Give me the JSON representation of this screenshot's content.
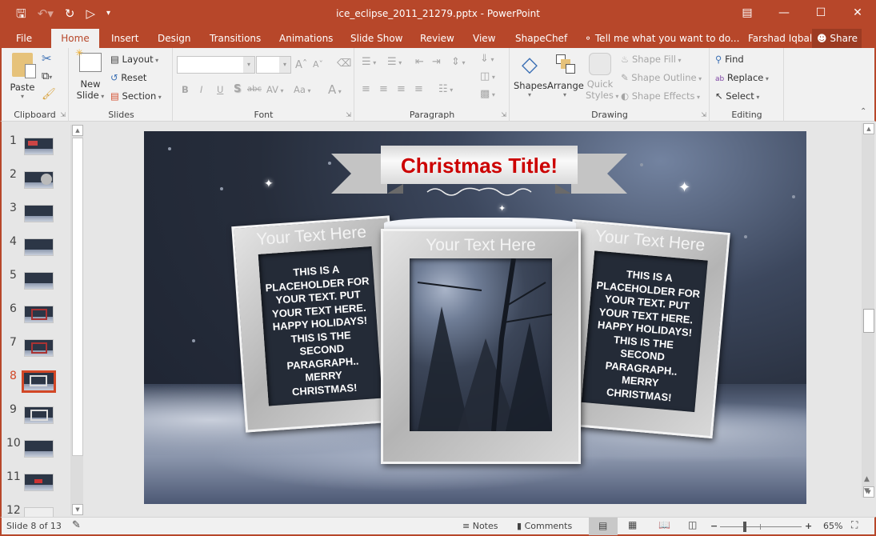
{
  "window": {
    "title": "ice_eclipse_2011_21279.pptx - PowerPoint",
    "controls": [
      "ribbon-display-options",
      "minimize",
      "maximize",
      "close"
    ]
  },
  "quick_access": {
    "icons": [
      "save-icon",
      "undo-icon",
      "redo-icon",
      "start-from-beginning-icon",
      "customize-qat-icon"
    ]
  },
  "tabs": [
    {
      "label": "File"
    },
    {
      "label": "Home",
      "active": true
    },
    {
      "label": "Insert"
    },
    {
      "label": "Design"
    },
    {
      "label": "Transitions"
    },
    {
      "label": "Animations"
    },
    {
      "label": "Slide Show"
    },
    {
      "label": "Review"
    },
    {
      "label": "View"
    },
    {
      "label": "ShapeChef"
    }
  ],
  "tell_me": "Tell me what you want to do...",
  "user": "Farshad Iqbal",
  "share": "Share",
  "ribbon": {
    "clipboard": {
      "label": "Clipboard",
      "paste": "Paste"
    },
    "slides": {
      "label": "Slides",
      "new_slide_1": "New",
      "new_slide_2": "Slide",
      "layout": "Layout",
      "reset": "Reset",
      "section": "Section"
    },
    "font": {
      "label": "Font",
      "font_name": "",
      "font_size": "",
      "bold": "B",
      "italic": "I",
      "underline": "U",
      "shadow": "S",
      "strike": "abc",
      "spacing": "AV",
      "case": "Aa",
      "color": "A"
    },
    "paragraph": {
      "label": "Paragraph"
    },
    "drawing": {
      "label": "Drawing",
      "shapes": "Shapes",
      "arrange": "Arrange",
      "quick_styles_1": "Quick",
      "quick_styles_2": "Styles",
      "shape_fill": "Shape Fill",
      "shape_outline": "Shape Outline",
      "shape_effects": "Shape Effects"
    },
    "editing": {
      "label": "Editing",
      "find": "Find",
      "replace": "Replace",
      "select": "Select"
    }
  },
  "thumbnails": [
    {
      "num": "1"
    },
    {
      "num": "2"
    },
    {
      "num": "3"
    },
    {
      "num": "4"
    },
    {
      "num": "5"
    },
    {
      "num": "6"
    },
    {
      "num": "7"
    },
    {
      "num": "8",
      "selected": true
    },
    {
      "num": "9"
    },
    {
      "num": "10"
    },
    {
      "num": "11"
    },
    {
      "num": "12"
    }
  ],
  "slide": {
    "title": "Christmas Title!",
    "title_color": "#cc0000",
    "frames": [
      {
        "title": "Your Text Here",
        "text": "THIS IS A PLACEHOLDER FOR YOUR TEXT. PUT YOUR TEXT HERE. HAPPY HOLIDAYS! THIS IS THE SECOND PARAGRAPH.. MERRY CHRISTMAS!"
      },
      {
        "title": "Your Text Here",
        "image": "snowy-forest-moon"
      },
      {
        "title": "Your Text Here",
        "text": "THIS IS A PLACEHOLDER FOR YOUR TEXT. PUT YOUR TEXT HERE. HAPPY HOLIDAYS! THIS IS THE SECOND PARAGRAPH.. MERRY CHRISTMAS!"
      }
    ]
  },
  "status": {
    "slide_info": "Slide 8 of 13",
    "notes": "Notes",
    "comments": "Comments",
    "zoom_level": "65%",
    "zoom_fraction": 0.65
  },
  "colors": {
    "accent": "#b7472a",
    "selected": "#d24726"
  }
}
